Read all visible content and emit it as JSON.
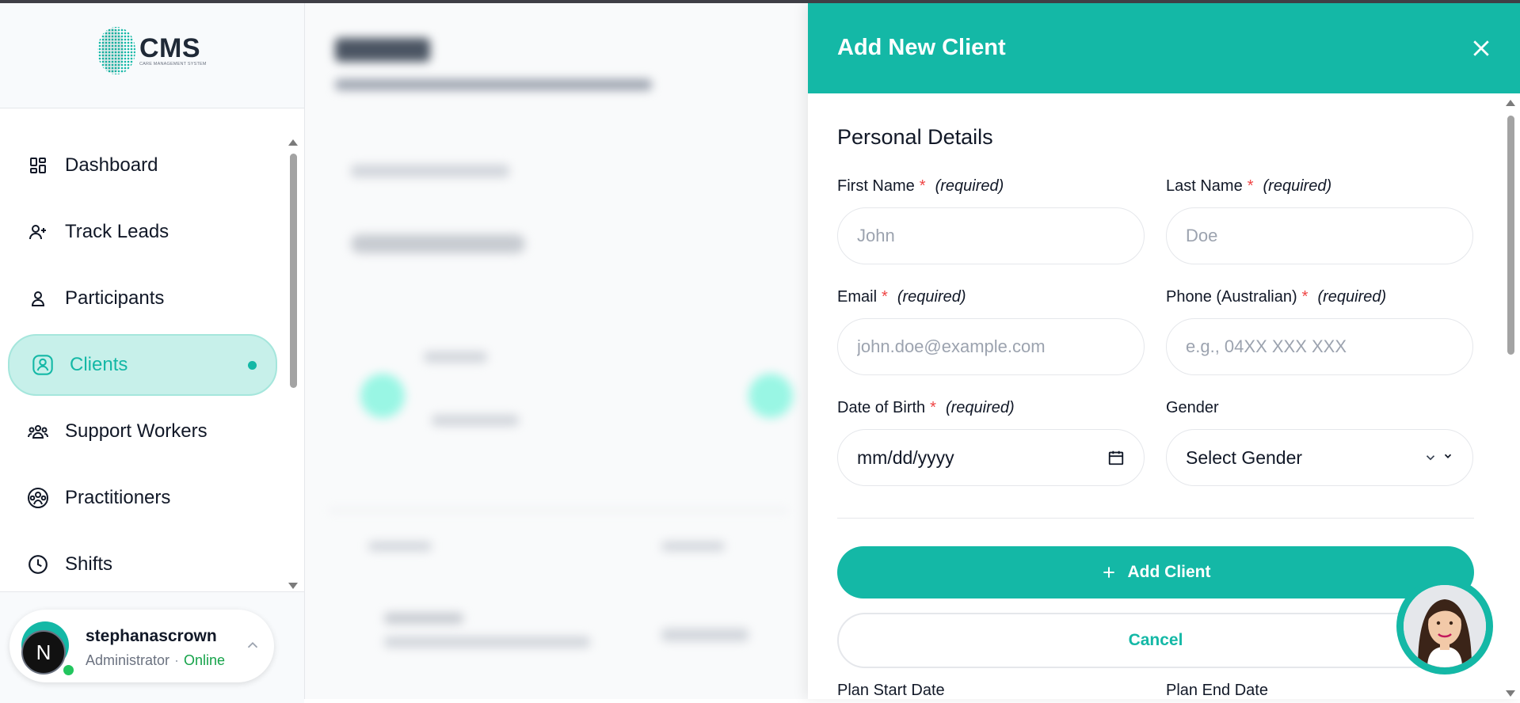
{
  "brand": {
    "logo_title": "CMS",
    "logo_subtitle": "CARE MANAGEMENT SYSTEM"
  },
  "sidebar": {
    "items": [
      {
        "label": "Dashboard",
        "icon": "dashboard-icon"
      },
      {
        "label": "Track Leads",
        "icon": "user-plus-icon"
      },
      {
        "label": "Participants",
        "icon": "user-icon"
      },
      {
        "label": "Clients",
        "icon": "clients-icon",
        "active": true
      },
      {
        "label": "Support Workers",
        "icon": "users-group-icon"
      },
      {
        "label": "Practitioners",
        "icon": "practitioners-icon"
      },
      {
        "label": "Shifts",
        "icon": "clock-icon"
      }
    ]
  },
  "user": {
    "initial": "N",
    "name": "stephanascrown",
    "role": "Administrator",
    "separator": "·",
    "status": "Online"
  },
  "drawer": {
    "title": "Add New Client",
    "section_title": "Personal Details",
    "required_star": "*",
    "required_text": "(required)",
    "fields": {
      "first_name": {
        "label": "First Name",
        "placeholder": "John"
      },
      "last_name": {
        "label": "Last Name",
        "placeholder": "Doe"
      },
      "email": {
        "label": "Email",
        "placeholder": "john.doe@example.com"
      },
      "phone": {
        "label": "Phone (Australian)",
        "placeholder": "e.g., 04XX XXX XXX"
      },
      "dob": {
        "label": "Date of Birth",
        "value": "mm/dd/yyyy"
      },
      "gender": {
        "label": "Gender",
        "value": "Select Gender"
      }
    },
    "add_button": "Add Client",
    "cancel_button": "Cancel",
    "plan_start_label": "Plan Start Date",
    "plan_end_label": "Plan End Date"
  },
  "colors": {
    "accent": "#14b8a6",
    "active_bg": "#c7f0ea",
    "online": "#16a34a",
    "required": "#ef4444"
  }
}
